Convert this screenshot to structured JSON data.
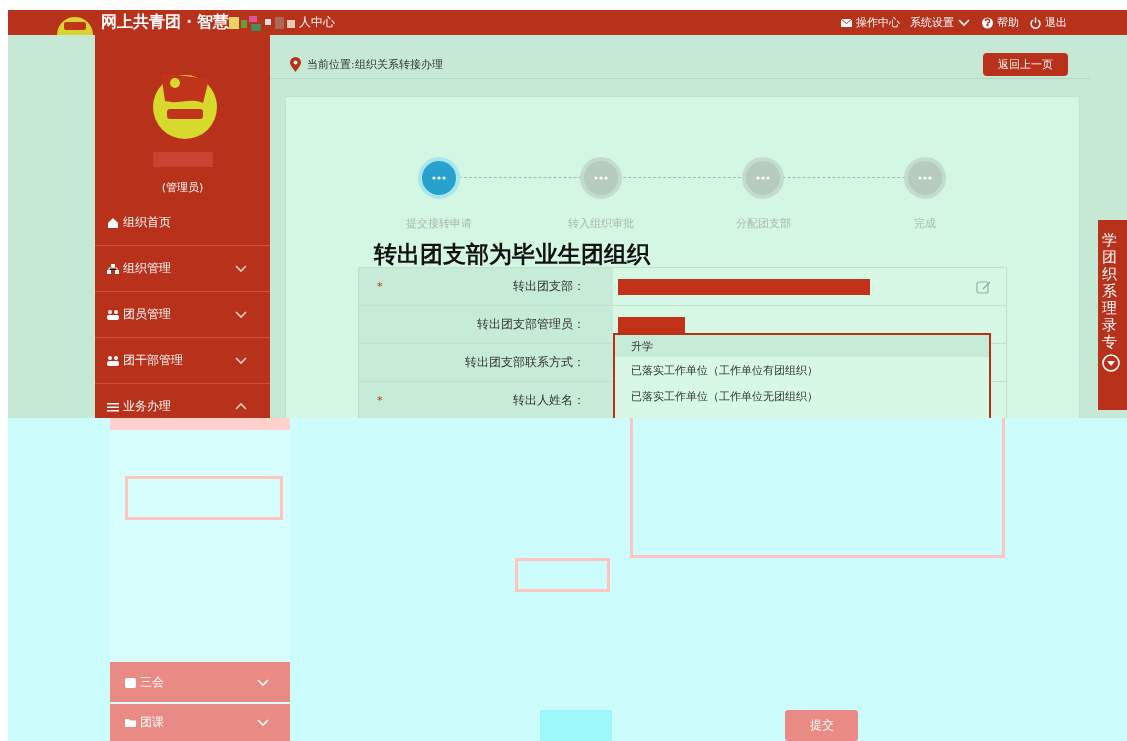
{
  "header": {
    "title": "网上共青团・智慧",
    "title_tail": "人中心",
    "links": [
      {
        "label": "操作中心"
      },
      {
        "label": "系统设置"
      },
      {
        "label": "帮助"
      },
      {
        "label": "退出"
      }
    ]
  },
  "sidebar": {
    "role": "(管理员)",
    "items": [
      {
        "label": "组织首页",
        "kind": "link"
      },
      {
        "label": "组织管理",
        "kind": "group",
        "expanded": false
      },
      {
        "label": "团员管理",
        "kind": "group",
        "expanded": false
      },
      {
        "label": "团干部管理",
        "kind": "group",
        "expanded": false
      },
      {
        "label": "业务办理",
        "kind": "group",
        "expanded": true
      }
    ]
  },
  "breadcrumb": {
    "text": "当前位置:组织关系转接办理",
    "back_button": "返回上一页"
  },
  "steps": [
    {
      "label": "提交接转申请",
      "active": true
    },
    {
      "label": "转入组织审批",
      "active": false
    },
    {
      "label": "分配团支部",
      "active": false
    },
    {
      "label": "完成",
      "active": false
    }
  ],
  "heading": "转出团支部为毕业生团组织",
  "form_rows": [
    {
      "required_mark": "*",
      "label": "转出团支部：",
      "kind": "redacted-long",
      "editable": true
    },
    {
      "label": "转出团支部管理员：",
      "kind": "redacted-short",
      "editable": false
    },
    {
      "label": "转出团支部联系方式：",
      "kind": "empty",
      "editable": false
    },
    {
      "required_mark": "*",
      "label": "转出人姓名：",
      "kind": "empty",
      "editable": false
    }
  ],
  "dropdown": {
    "options": [
      {
        "label": "升学",
        "selected": true
      },
      {
        "label": "已落实工作单位（工作单位有团组织）",
        "selected": false
      },
      {
        "label": "已落实工作单位（工作单位无团组织）",
        "selected": false
      }
    ]
  },
  "side_panel": {
    "lines": [
      "学",
      "团",
      "织",
      "系",
      "理",
      "录",
      "专"
    ]
  },
  "faded_section": {
    "sidebar_items": [
      {
        "label": "三会",
        "expanded": false
      },
      {
        "label": "团课",
        "expanded": false
      }
    ],
    "buttons": [
      {
        "kind": "cyan"
      },
      {
        "kind": "pink",
        "label": "提交"
      }
    ]
  }
}
